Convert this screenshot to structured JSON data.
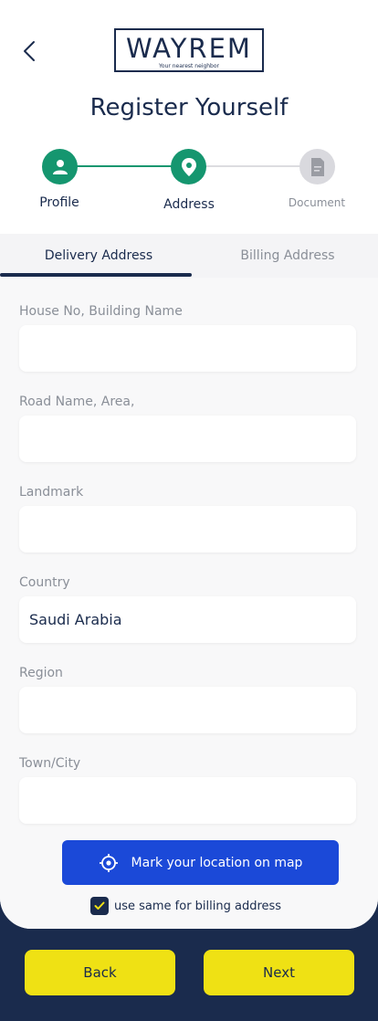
{
  "header": {
    "back_icon": "chevron-left-icon",
    "logo_text": "WAYREM",
    "logo_tagline": "Your nearest neighbor",
    "title": "Register Yourself"
  },
  "stepper": {
    "steps": [
      {
        "label": "Profile",
        "icon": "user-icon",
        "state": "complete"
      },
      {
        "label": "Address",
        "icon": "location-pin-icon",
        "state": "active"
      },
      {
        "label": "Document",
        "icon": "document-icon",
        "state": "pending"
      }
    ],
    "colors": {
      "complete": "#15966f",
      "pending": "#d9d9de"
    }
  },
  "tabs": [
    {
      "label": "Delivery Address",
      "active": true
    },
    {
      "label": "Billing  Address",
      "active": false
    }
  ],
  "form": {
    "fields": [
      {
        "label": "House No, Building Name",
        "value": ""
      },
      {
        "label": "Road Name, Area,",
        "value": ""
      },
      {
        "label": "Landmark",
        "value": ""
      },
      {
        "label": "Country",
        "value": "Saudi Arabia"
      },
      {
        "label": "Region",
        "value": ""
      },
      {
        "label": "Town/City",
        "value": ""
      }
    ]
  },
  "map_button": {
    "label": "Mark your location on map",
    "icon": "crosshair-icon",
    "color": "#1b49d8"
  },
  "billing_checkbox": {
    "label": "use same for billing address",
    "checked": true
  },
  "footer": {
    "back_label": "Back",
    "next_label": "Next",
    "button_color": "#efe114"
  }
}
